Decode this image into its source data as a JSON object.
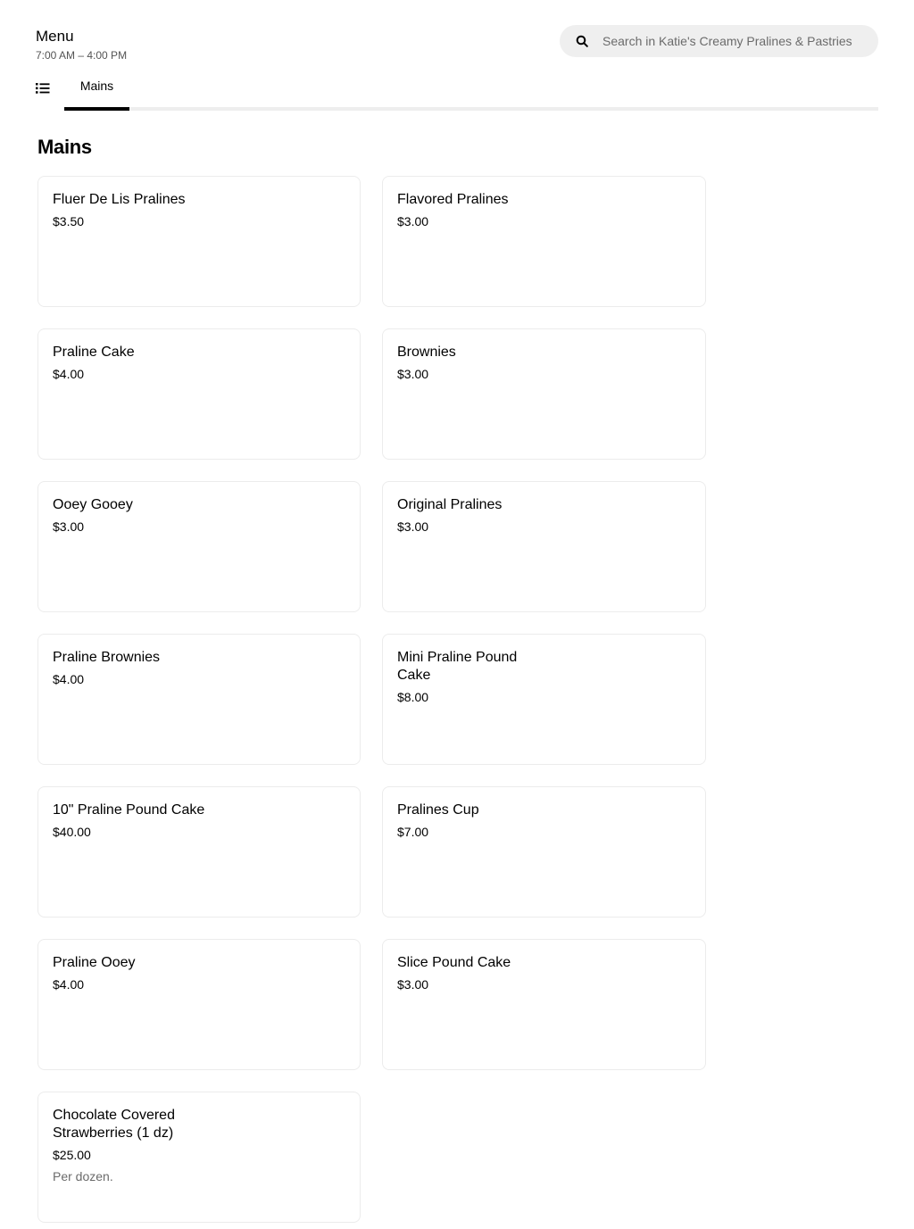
{
  "header": {
    "title": "Menu",
    "hours": "7:00 AM – 4:00 PM",
    "search_placeholder": "Search in Katie's Creamy Pralines & Pastries"
  },
  "icons": {
    "search": "search-icon",
    "menu_list": "list-icon"
  },
  "tabs": [
    {
      "label": "Mains",
      "active": true
    }
  ],
  "section": {
    "title": "Mains"
  },
  "items": [
    {
      "name": "Fluer De Lis Pralines",
      "price": "$3.50",
      "description": ""
    },
    {
      "name": "Flavored Pralines",
      "price": "$3.00",
      "description": ""
    },
    {
      "name": "Praline Cake",
      "price": "$4.00",
      "description": ""
    },
    {
      "name": "Brownies",
      "price": "$3.00",
      "description": ""
    },
    {
      "name": "Ooey Gooey",
      "price": "$3.00",
      "description": ""
    },
    {
      "name": "Original Pralines",
      "price": "$3.00",
      "description": ""
    },
    {
      "name": "Praline Brownies",
      "price": "$4.00",
      "description": ""
    },
    {
      "name": "Mini Praline Pound Cake",
      "price": "$8.00",
      "description": ""
    },
    {
      "name": "10\" Praline Pound Cake",
      "price": "$40.00",
      "description": ""
    },
    {
      "name": "Pralines Cup",
      "price": "$7.00",
      "description": ""
    },
    {
      "name": "Praline Ooey",
      "price": "$4.00",
      "description": ""
    },
    {
      "name": "Slice Pound Cake",
      "price": "$3.00",
      "description": ""
    },
    {
      "name": "Chocolate Covered Strawberries (1 dz)",
      "price": "$25.00",
      "description": "Per dozen."
    }
  ]
}
